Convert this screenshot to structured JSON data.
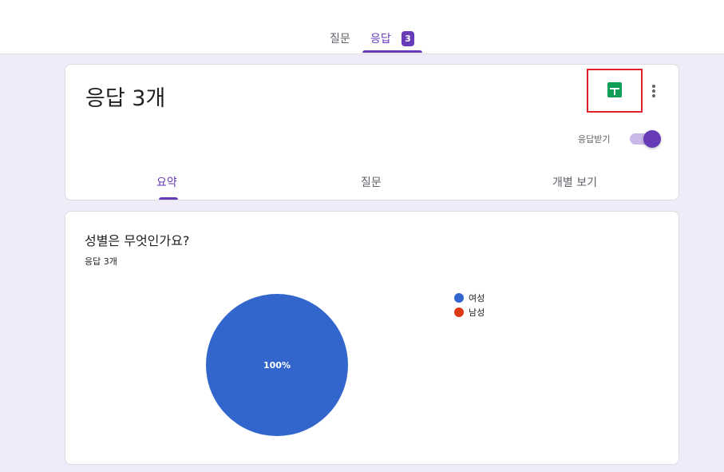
{
  "top_tabs": {
    "questions": "질문",
    "responses": "응답",
    "response_count": "3"
  },
  "header": {
    "title": "응답 3개",
    "sheets_icon": "google-sheets-icon",
    "more_icon": "more-vertical-icon",
    "accepting_label": "응답받기",
    "accepting_responses": true
  },
  "sub_tabs": {
    "summary": "요약",
    "question": "질문",
    "individual": "개별 보기"
  },
  "question_card": {
    "title": "성별은 무엇인가요?",
    "response_count": "응답 3개"
  },
  "colors": {
    "accent": "#673ab7",
    "sheets_green": "#0f9d58",
    "highlight_red": "#e0202a"
  },
  "chart_data": {
    "type": "pie",
    "title": "",
    "labels": [
      "여성",
      "남성"
    ],
    "values": [
      100,
      0
    ],
    "unit": "%",
    "colors": [
      "#3366cc",
      "#dc3912"
    ],
    "data_labels": [
      "100%"
    ],
    "legend_position": "right"
  }
}
